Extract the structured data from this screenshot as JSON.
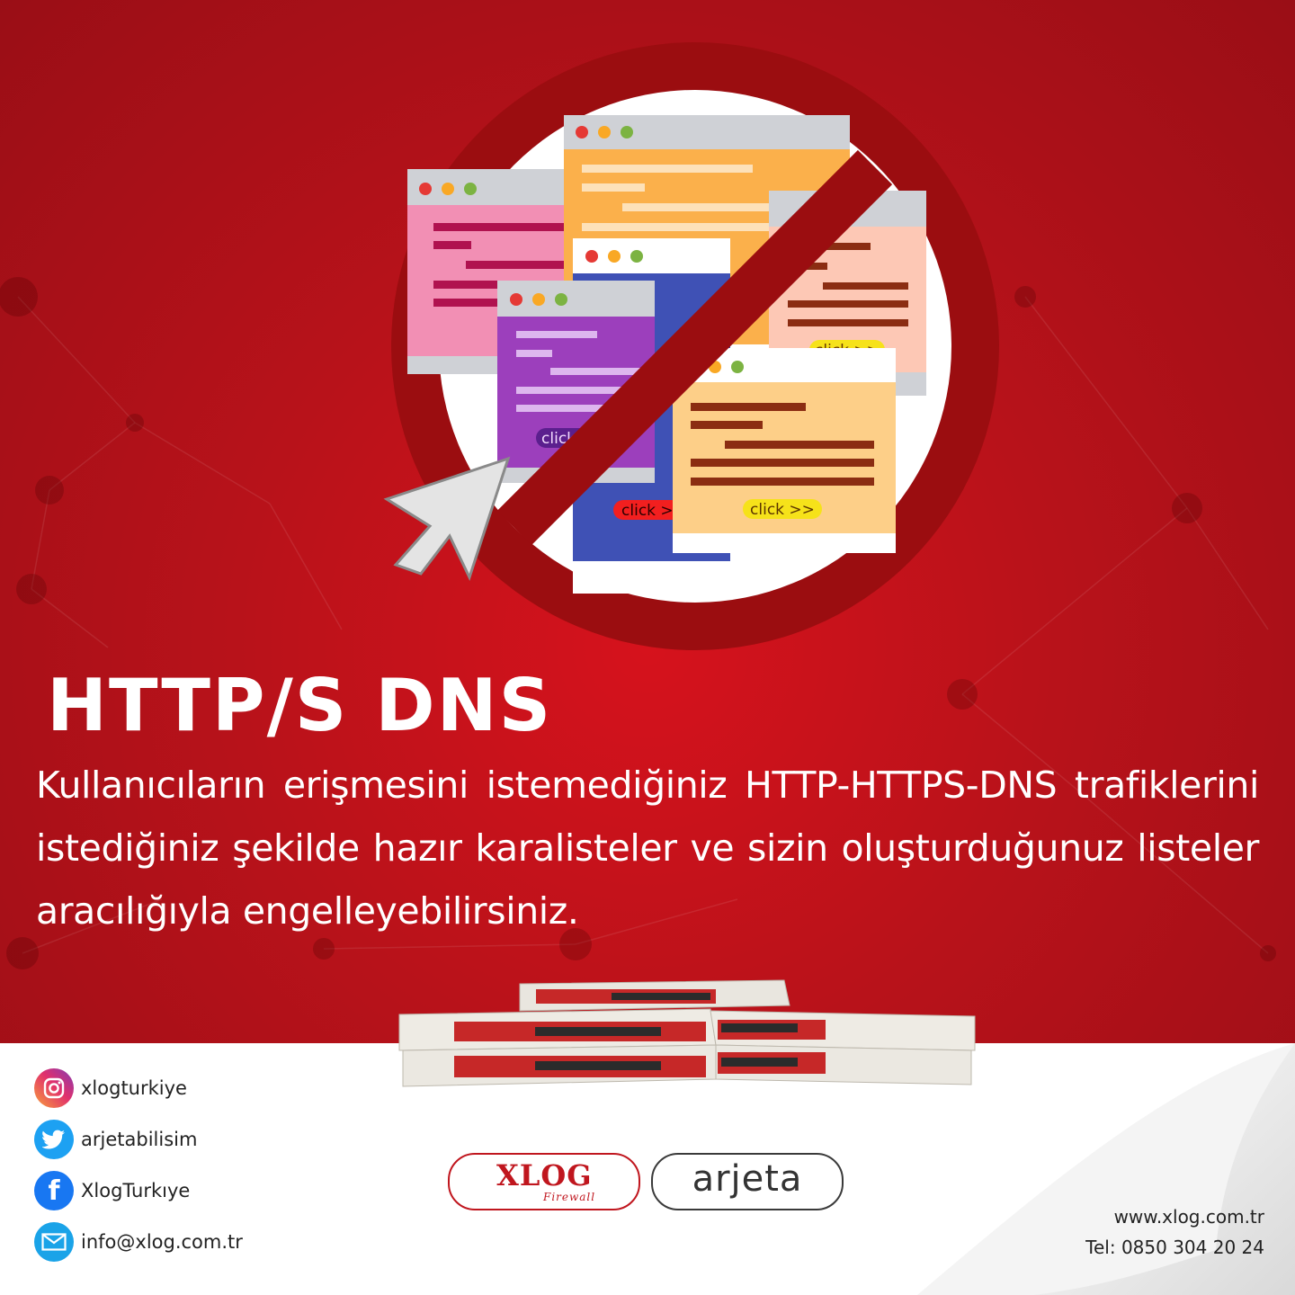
{
  "headline": "HTTP/S DNS",
  "description": "Kullanıcıların erişmesini istemediğiniz HTTP-HTTPS-DNS trafiklerini istediğiniz şekilde hazır karalisteler ve sizin oluşturduğunuz listeler aracılığıyla engelleyebilirsiniz.",
  "illustration": {
    "subject": "no-entry-sign-over-browser-windows",
    "buttons": [
      "click >>",
      "click >>",
      "click >>",
      "click >>"
    ]
  },
  "social": [
    {
      "icon": "instagram-icon",
      "label": "xlogturkiye"
    },
    {
      "icon": "twitter-icon",
      "label": "arjetabilisim"
    },
    {
      "icon": "facebook-icon",
      "label": "XlogTurkıye"
    },
    {
      "icon": "mail-icon",
      "label": "info@xlog.com.tr"
    }
  ],
  "logos": {
    "xlog": "XLOG",
    "xlog_sub": "Firewall",
    "arjeta": "arjeta"
  },
  "contact": {
    "website": "www.xlog.com.tr",
    "phone": "Tel: 0850 304 20 24"
  },
  "colors": {
    "brand_red": "#c0161e",
    "background_red": "#b8121a",
    "white": "#ffffff"
  }
}
